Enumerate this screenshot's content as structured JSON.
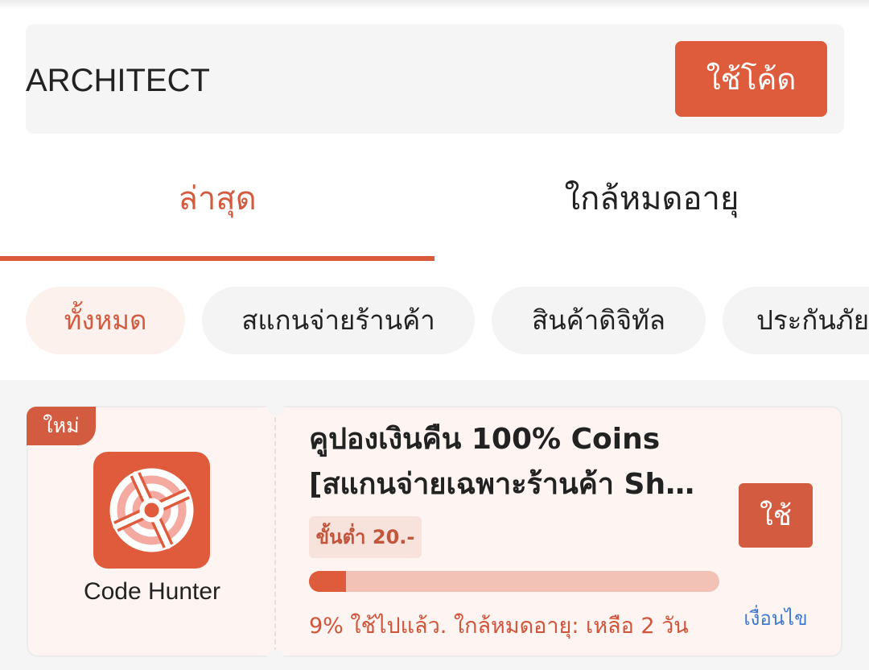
{
  "promo": {
    "code_value": "ARCHITECT",
    "apply_label": "ใช้โค้ด"
  },
  "tabs": [
    {
      "label": "ล่าสุด",
      "active": true
    },
    {
      "label": "ใกล้หมดอายุ",
      "active": false
    }
  ],
  "chips": [
    {
      "label": "ทั้งหมด",
      "active": true
    },
    {
      "label": "สแกนจ่ายร้านค้า",
      "active": false
    },
    {
      "label": "สินค้าดิจิทัล",
      "active": false
    },
    {
      "label": "ประกันภัย",
      "active": false
    }
  ],
  "coupon": {
    "badge": "ใหม่",
    "shop_name": "Code Hunter",
    "logo_icon": "crosshair-icon",
    "title_line1": "คูปองเงินคืน 100% Coins",
    "title_line2": "[สแกนจ่ายเฉพาะร้านค้า Sh…",
    "min_spend": "ขั้นต่ำ 20.-",
    "used_percent": 9,
    "status_text": "9% ใช้ไปแล้ว. ใกล้หมดอายุ: เหลือ 2 วัน",
    "use_label": "ใช้",
    "terms_label": "เงื่อนไข"
  },
  "colors": {
    "accent": "#de5b3c",
    "accent_text": "#d35c40",
    "card_bg": "#fef4f1",
    "link": "#3d7ad1"
  }
}
